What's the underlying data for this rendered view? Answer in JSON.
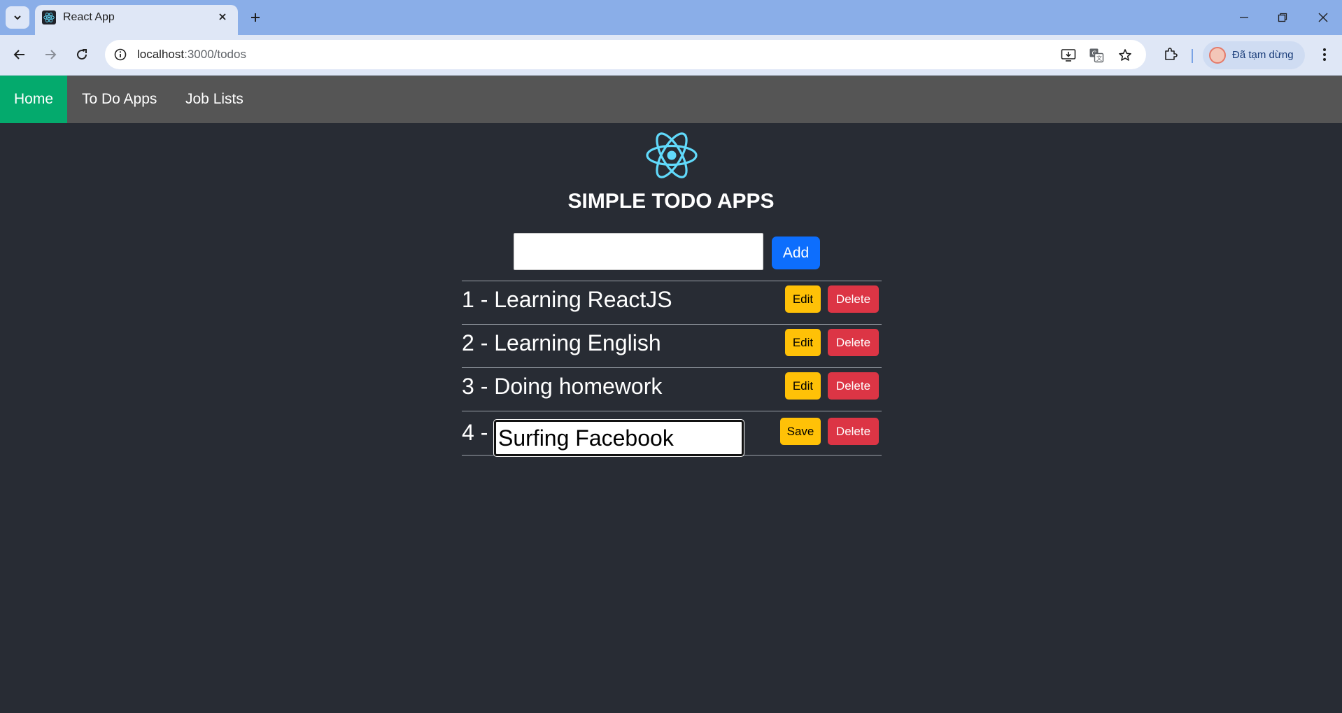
{
  "browser": {
    "tab_title": "React App",
    "url_host": "localhost",
    "url_path": ":3000/todos",
    "profile_label": "Đã tạm dừng"
  },
  "nav": {
    "links": [
      "Home",
      "To Do Apps",
      "Job Lists"
    ],
    "active": "Home"
  },
  "app": {
    "title": "SIMPLE TODO APPS",
    "new_todo_value": "",
    "add_label": "Add",
    "logo_color": "#61dafb"
  },
  "todos": [
    {
      "prefix": "1 - ",
      "text": "Learning ReactJS",
      "action_label": "Edit",
      "delete_label": "Delete",
      "editing": false
    },
    {
      "prefix": "2 - ",
      "text": "Learning English",
      "action_label": "Edit",
      "delete_label": "Delete",
      "editing": false
    },
    {
      "prefix": "3 - ",
      "text": "Doing homework",
      "action_label": "Edit",
      "delete_label": "Delete",
      "editing": false
    },
    {
      "prefix": "4 - ",
      "text": "Surfing Facebook",
      "action_label": "Save",
      "delete_label": "Delete",
      "editing": true
    }
  ],
  "colors": {
    "nav_active": "#04aa6d",
    "nav_bg": "#555555",
    "page_bg": "#282c34",
    "primary": "#0d6efd",
    "warning": "#ffc107",
    "danger": "#dc3545"
  }
}
